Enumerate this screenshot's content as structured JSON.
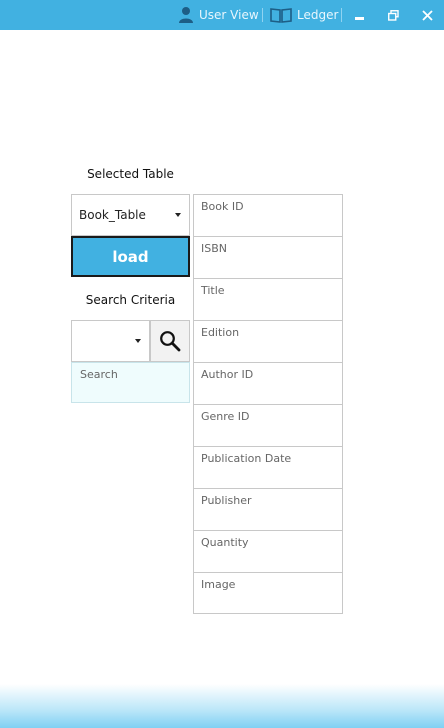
{
  "colors": {
    "accent": "#41b1e1",
    "search_bg": "#effcfd"
  },
  "titlebar": {
    "user_view_label": "User View",
    "user_icon": "user-icon",
    "ledger_label": "Ledger",
    "ledger_icon": "book-icon",
    "minimize_icon": "minimize-icon",
    "restore_icon": "restore-icon",
    "close_icon": "close-icon"
  },
  "table_select": {
    "label": "Selected Table",
    "value": "Book_Table"
  },
  "load_button": {
    "label": "load"
  },
  "criteria_select": {
    "label": "Search Criteria",
    "value": ""
  },
  "search": {
    "placeholder": "Search",
    "icon": "search-icon"
  },
  "fields": [
    "Book ID",
    "ISBN",
    "Title",
    "Edition",
    "Author ID",
    "Genre ID",
    "Publication Date",
    "Publisher",
    "Quantity",
    "Image"
  ]
}
